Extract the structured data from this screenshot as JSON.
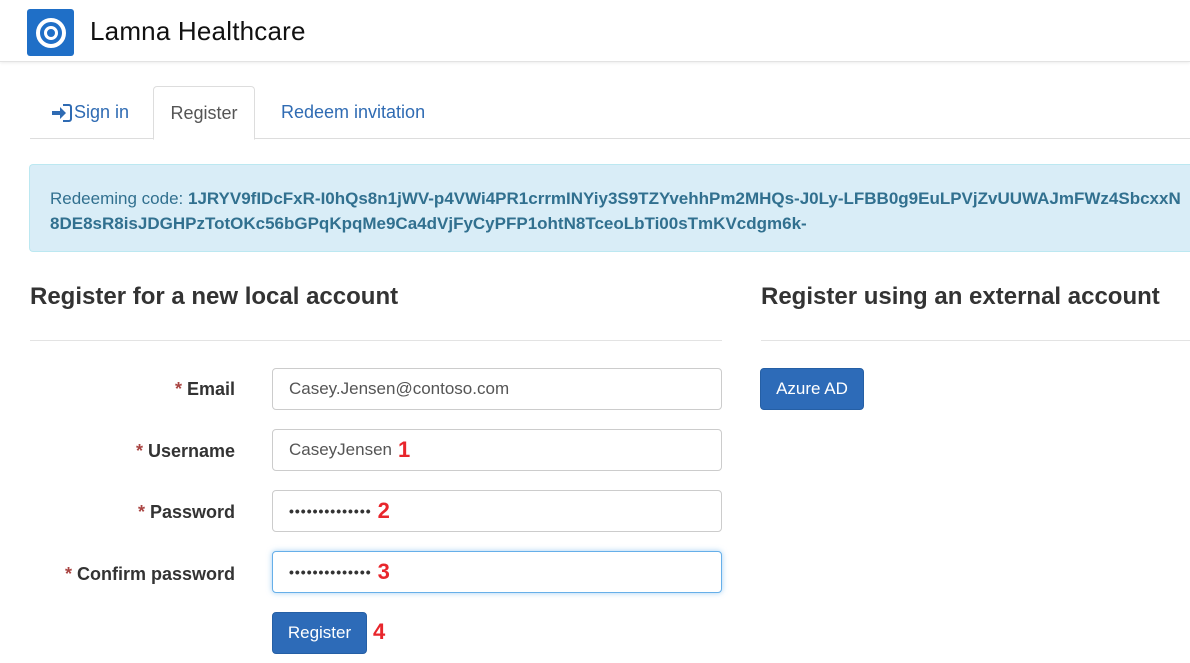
{
  "header": {
    "brand": "Lamna Healthcare",
    "logo_icon": "lamna-logo-icon"
  },
  "tabs": [
    {
      "label": "Sign in",
      "icon": "sign-in-icon",
      "active": false
    },
    {
      "label": "Register",
      "active": true
    },
    {
      "label": "Redeem invitation",
      "active": false
    }
  ],
  "alert": {
    "prefix": "Redeeming code: ",
    "code": "1JRYV9fIDcFxR-I0hQs8n1jWV-p4VWi4PR1crrmINYiy3S9TZYvehhPm2MHQs-J0Ly-LFBB0g9EuLPVjZvUUWAJmFWz4SbcxxN8DE8sR8isJDGHPzTotOKc56bGPqKpqMe9Ca4dVjFyCyPFP1ohtN8TceoLbTi00sTmKVcdgm6k-"
  },
  "local": {
    "heading": "Register for a new local account",
    "required_mark": "*",
    "email": {
      "label": "Email",
      "value": "Casey.Jensen@contoso.com"
    },
    "username": {
      "label": "Username",
      "value": "CaseyJensen",
      "step": "1"
    },
    "password": {
      "label": "Password",
      "value": "••••••••••••••",
      "step": "2"
    },
    "confirm": {
      "label": "Confirm password",
      "value": "••••••••••••••",
      "step": "3"
    },
    "register_button": "Register",
    "register_step": "4"
  },
  "external": {
    "heading": "Register using an external account",
    "azure_button": "Azure AD"
  },
  "colors": {
    "primary": "#2d6bb8",
    "alert_bg": "#d9edf7",
    "alert_text": "#31708f",
    "required": "#a94442",
    "step_marker": "#e8262c"
  }
}
